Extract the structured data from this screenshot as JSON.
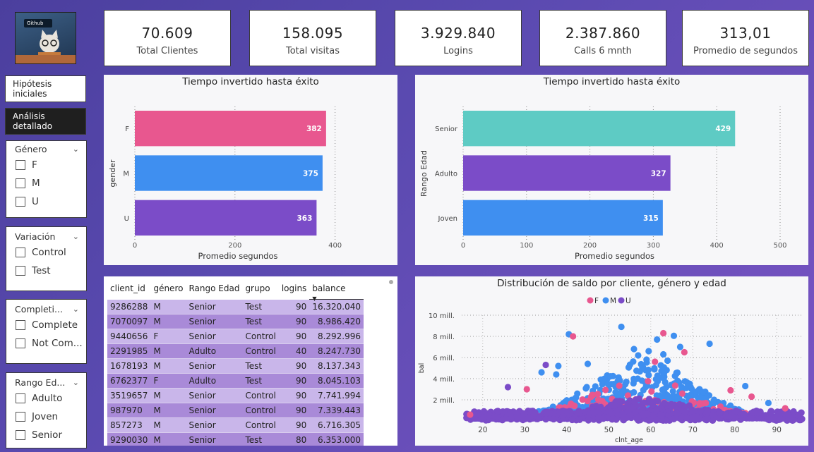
{
  "logo": {
    "text": "Github"
  },
  "kpis": [
    {
      "value": "70.609",
      "label": "Total Clientes"
    },
    {
      "value": "158.095",
      "label": "Total visitas"
    },
    {
      "value": "3.929.840",
      "label": "Logins"
    },
    {
      "value": "2.387.860",
      "label": "Calls 6 mnth"
    },
    {
      "value": "313,01",
      "label": "Promedio de segundos"
    }
  ],
  "nav": {
    "hipotesis": "Hipótesis iniciales",
    "analisis": "Análisis detallado"
  },
  "slicers": {
    "genero": {
      "title": "Género",
      "options": [
        "F",
        "M",
        "U"
      ]
    },
    "variacion": {
      "title": "Variación",
      "options": [
        "Control",
        "Test"
      ]
    },
    "completion": {
      "title": "Completi...",
      "options": [
        "Complete",
        "Not Com..."
      ]
    },
    "rango": {
      "title": "Rango Ed...",
      "options": [
        "Adulto",
        "Joven",
        "Senior"
      ]
    }
  },
  "colors": {
    "F": "#e8578f",
    "M": "#3f8ff0",
    "U": "#7b4cc8",
    "Senior": "#5ecbc4",
    "Adulto": "#7b4cc8",
    "Joven": "#3f8ff0"
  },
  "chart_data": [
    {
      "type": "bar",
      "orientation": "horizontal",
      "title": "Tiempo invertido hasta éxito",
      "xlabel": "Promedio segundos",
      "ylabel": "gender",
      "categories": [
        "F",
        "M",
        "U"
      ],
      "values": [
        382,
        375,
        363
      ],
      "xlim": [
        0,
        440
      ],
      "xticks": [
        0,
        200,
        400
      ],
      "grid": true
    },
    {
      "type": "bar",
      "orientation": "horizontal",
      "title": "Tiempo invertido hasta éxito",
      "xlabel": "Promedio segundos",
      "ylabel": "Rango Edad",
      "categories": [
        "Senior",
        "Adulto",
        "Joven"
      ],
      "values": [
        429,
        327,
        315
      ],
      "xlim": [
        0,
        500
      ],
      "xticks": [
        0,
        100,
        200,
        300,
        400,
        500
      ],
      "grid": true
    },
    {
      "type": "scatter",
      "title": "Distribución de saldo por cliente, género y edad",
      "xlabel": "clnt_age",
      "ylabel": "bal",
      "legend": [
        "F",
        "M",
        "U"
      ],
      "legend_position": "top",
      "xlim": [
        15,
        96
      ],
      "ylim": [
        0,
        10000000
      ],
      "xticks": [
        20,
        30,
        40,
        50,
        60,
        70,
        80,
        90
      ],
      "yticks": [
        2000000,
        4000000,
        6000000,
        8000000,
        10000000
      ],
      "ytick_labels": [
        "2 mill.",
        "4 mill.",
        "6 mill.",
        "8 mill.",
        "10 mill."
      ],
      "highlight_points": [
        {
          "g": "M",
          "x": 40.5,
          "y": 8200000
        },
        {
          "g": "F",
          "x": 41.5,
          "y": 8000000
        },
        {
          "g": "M",
          "x": 53,
          "y": 8900000
        },
        {
          "g": "F",
          "x": 63,
          "y": 8300000
        },
        {
          "g": "M",
          "x": 65.5,
          "y": 8050000
        },
        {
          "g": "M",
          "x": 61.5,
          "y": 7700000
        },
        {
          "g": "M",
          "x": 74,
          "y": 7300000
        },
        {
          "g": "M",
          "x": 67,
          "y": 7000000
        },
        {
          "g": "M",
          "x": 56,
          "y": 6800000
        },
        {
          "g": "M",
          "x": 59.5,
          "y": 6600000
        },
        {
          "g": "F",
          "x": 68,
          "y": 6500000
        },
        {
          "g": "M",
          "x": 63,
          "y": 6300000
        },
        {
          "g": "M",
          "x": 57,
          "y": 6200000
        },
        {
          "g": "M",
          "x": 59,
          "y": 5800000
        },
        {
          "g": "M",
          "x": 64,
          "y": 5700000
        },
        {
          "g": "F",
          "x": 61,
          "y": 5600000
        },
        {
          "g": "M",
          "x": 45,
          "y": 5400000
        },
        {
          "g": "M",
          "x": 38,
          "y": 5200000
        },
        {
          "g": "M",
          "x": 34,
          "y": 4600000
        },
        {
          "g": "U",
          "x": 35,
          "y": 5300000
        },
        {
          "g": "M",
          "x": 37.5,
          "y": 4400000
        },
        {
          "g": "U",
          "x": 26,
          "y": 3200000
        },
        {
          "g": "F",
          "x": 30.5,
          "y": 3000000
        },
        {
          "g": "M",
          "x": 82.5,
          "y": 3300000
        },
        {
          "g": "F",
          "x": 79,
          "y": 2900000
        },
        {
          "g": "F",
          "x": 84,
          "y": 2300000
        },
        {
          "g": "M",
          "x": 88,
          "y": 1700000
        },
        {
          "g": "F",
          "x": 92,
          "y": 1200000
        },
        {
          "g": "U",
          "x": 94,
          "y": 900000
        },
        {
          "g": "F",
          "x": 17,
          "y": 600000
        }
      ]
    }
  ],
  "table": {
    "columns": [
      "client_id",
      "género",
      "Rango Edad",
      "grupo",
      "logins",
      "balance"
    ],
    "rows": [
      [
        "9286288",
        "M",
        "Senior",
        "Test",
        "90",
        "16.320.040"
      ],
      [
        "7070097",
        "M",
        "Senior",
        "Test",
        "90",
        "8.986.420"
      ],
      [
        "9440656",
        "F",
        "Senior",
        "Control",
        "90",
        "8.292.996"
      ],
      [
        "2291985",
        "M",
        "Adulto",
        "Control",
        "40",
        "8.247.730"
      ],
      [
        "1678193",
        "M",
        "Senior",
        "Test",
        "90",
        "8.137.343"
      ],
      [
        "6762377",
        "F",
        "Adulto",
        "Test",
        "90",
        "8.045.103"
      ],
      [
        "3519657",
        "M",
        "Senior",
        "Control",
        "90",
        "7.741.994"
      ],
      [
        "987970",
        "M",
        "Senior",
        "Control",
        "90",
        "7.339.443"
      ],
      [
        "857273",
        "M",
        "Senior",
        "Control",
        "90",
        "6.716.305"
      ],
      [
        "9290030",
        "M",
        "Senior",
        "Test",
        "80",
        "6.353.000"
      ]
    ]
  }
}
